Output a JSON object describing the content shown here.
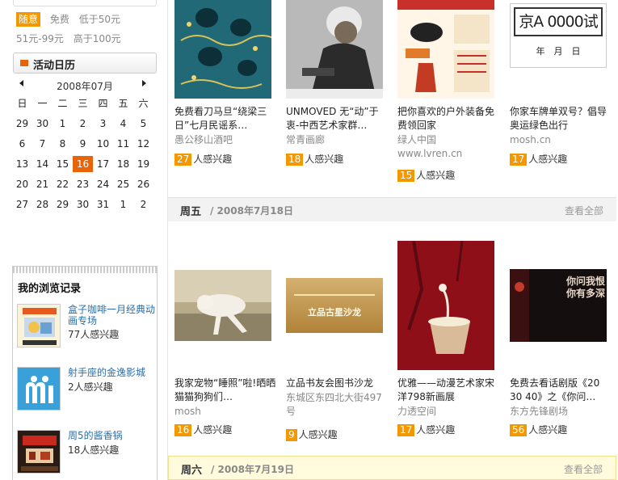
{
  "price_filter": {
    "row1": [
      "随意",
      "免费",
      "低于50元"
    ],
    "row2": [
      "51元-99元",
      "高于100元"
    ]
  },
  "calendar": {
    "title": "活动日历",
    "month": "2008年07月",
    "weekdays": [
      "日",
      "一",
      "二",
      "三",
      "四",
      "五",
      "六"
    ],
    "weeks": [
      [
        "29",
        "30",
        "1",
        "2",
        "3",
        "4",
        "5"
      ],
      [
        "6",
        "7",
        "8",
        "9",
        "10",
        "11",
        "12"
      ],
      [
        "13",
        "14",
        "15",
        "16",
        "17",
        "18",
        "19"
      ],
      [
        "20",
        "21",
        "22",
        "23",
        "24",
        "25",
        "26"
      ],
      [
        "27",
        "28",
        "29",
        "30",
        "31",
        "1",
        "2"
      ]
    ],
    "today": "16"
  },
  "history": {
    "title": "我的浏览记录",
    "items": [
      {
        "name": "盒子咖啡一月经典动画专场",
        "count": "77人感兴趣"
      },
      {
        "name": "射手座的金逸影城",
        "count": "2人感兴趣"
      },
      {
        "name": "周5的酱香锅",
        "count": "18人感兴趣"
      }
    ]
  },
  "interest_suffix": "人感兴趣",
  "row1": [
    {
      "title": "免费看刀马旦“绕梁三日”七月民谣系…",
      "source": "愚公移山酒吧",
      "count": "27"
    },
    {
      "title": "UNMOVED 无“动”于衷-中西艺术家群…",
      "source": "常青画廊",
      "count": "18"
    },
    {
      "title": "把你喜欢的户外装备免费领回家",
      "source": "绿人中国 www.lvren.cn",
      "count": "15"
    },
    {
      "title": "你家车牌单双号？倡导奥运绿色出行",
      "source": "mosh.cn",
      "count": "17"
    }
  ],
  "day1": {
    "weekday": "周五",
    "date": "/ 2008年7月18日",
    "view_all": "查看全部"
  },
  "row2": [
    {
      "title": "我家宠物“睡照”啦!晒晒猫猫狗狗们…",
      "source": "mosh",
      "count": "16"
    },
    {
      "title": "立品书友会图书沙龙",
      "source": "东城区东四北大街497号",
      "count": "9"
    },
    {
      "title": "优雅——动漫艺术家宋洋798新画展",
      "source": "力透空间",
      "count": "17"
    },
    {
      "title": "免费去看话剧版《20 30 40》之《你问…",
      "source": "东方先锋剧场",
      "count": "56"
    }
  ],
  "day2": {
    "weekday": "周六",
    "date": "/ 2008年7月19日",
    "view_all": "查看全部"
  },
  "poster_text": {
    "plate": "京A 0000试",
    "plate_sub": "年　月　日",
    "salon": "立品古星沙龙",
    "drama": "你问我恨你有多深"
  },
  "colors": {
    "accent": "#e8630a",
    "badge": "#f39800",
    "link": "#2a6fa8"
  }
}
